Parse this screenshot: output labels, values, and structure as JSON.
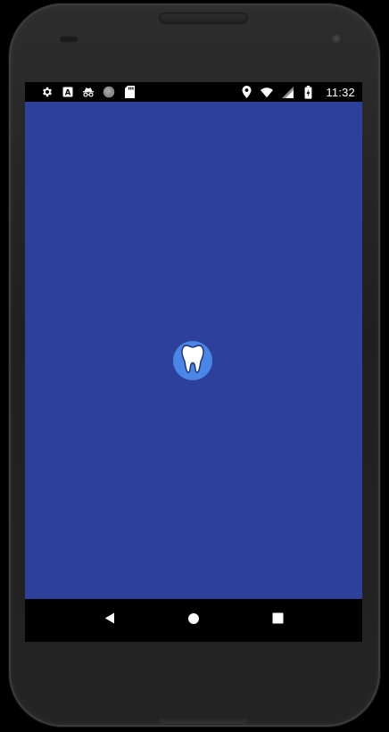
{
  "statusbar": {
    "left_icons": [
      "gear-icon",
      "a-square-icon",
      "incognito-icon",
      "circle-icon",
      "sd-card-icon"
    ],
    "right_icons": [
      "location-pin-icon",
      "wifi-icon",
      "signal-icon",
      "battery-icon"
    ],
    "time": "11:32"
  },
  "app": {
    "background_color": "#2d419a",
    "logo_icon": "tooth-icon",
    "logo_badge_color": "#4a86e8"
  },
  "navbar": {
    "buttons": [
      "back-icon",
      "home-icon",
      "recents-icon"
    ]
  }
}
